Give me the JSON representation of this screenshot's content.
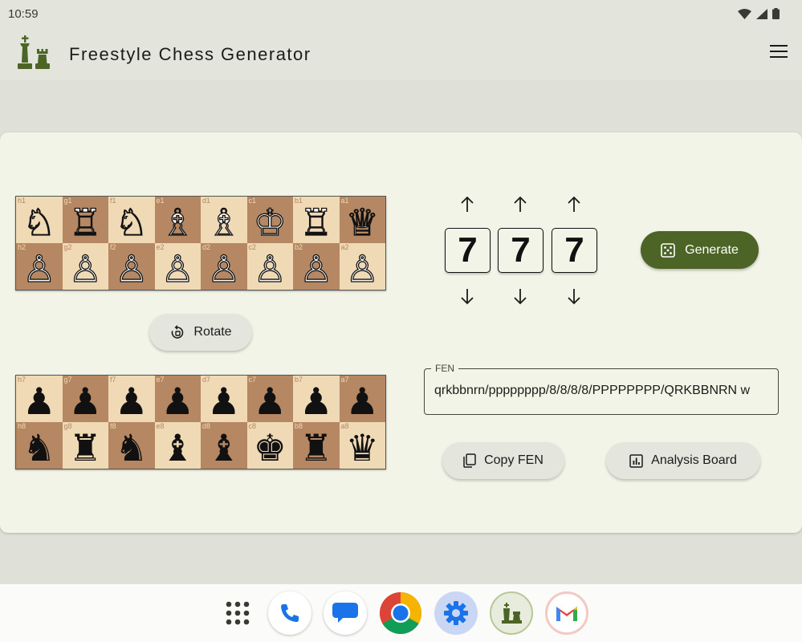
{
  "status_bar": {
    "time": "10:59"
  },
  "app_bar": {
    "title": "Freestyle Chess Generator"
  },
  "white_board": {
    "rows": [
      [
        {
          "coord": "h1",
          "glyph": "♘"
        },
        {
          "coord": "g1",
          "glyph": "♖"
        },
        {
          "coord": "f1",
          "glyph": "♘"
        },
        {
          "coord": "e1",
          "glyph": "♗"
        },
        {
          "coord": "d1",
          "glyph": "♗"
        },
        {
          "coord": "c1",
          "glyph": "♔"
        },
        {
          "coord": "b1",
          "glyph": "♖"
        },
        {
          "coord": "a1",
          "glyph": "♕"
        }
      ],
      [
        {
          "coord": "h2",
          "glyph": "♙"
        },
        {
          "coord": "g2",
          "glyph": "♙"
        },
        {
          "coord": "f2",
          "glyph": "♙"
        },
        {
          "coord": "e2",
          "glyph": "♙"
        },
        {
          "coord": "d2",
          "glyph": "♙"
        },
        {
          "coord": "c2",
          "glyph": "♙"
        },
        {
          "coord": "b2",
          "glyph": "♙"
        },
        {
          "coord": "a2",
          "glyph": "♙"
        }
      ]
    ]
  },
  "black_board": {
    "rows": [
      [
        {
          "coord": "h7",
          "glyph": "♟"
        },
        {
          "coord": "g7",
          "glyph": "♟"
        },
        {
          "coord": "f7",
          "glyph": "♟"
        },
        {
          "coord": "e7",
          "glyph": "♟"
        },
        {
          "coord": "d7",
          "glyph": "♟"
        },
        {
          "coord": "c7",
          "glyph": "♟"
        },
        {
          "coord": "b7",
          "glyph": "♟"
        },
        {
          "coord": "a7",
          "glyph": "♟"
        }
      ],
      [
        {
          "coord": "h8",
          "glyph": "♞"
        },
        {
          "coord": "g8",
          "glyph": "♜"
        },
        {
          "coord": "f8",
          "glyph": "♞"
        },
        {
          "coord": "e8",
          "glyph": "♝"
        },
        {
          "coord": "d8",
          "glyph": "♝"
        },
        {
          "coord": "c8",
          "glyph": "♚"
        },
        {
          "coord": "b8",
          "glyph": "♜"
        },
        {
          "coord": "a8",
          "glyph": "♛"
        }
      ]
    ]
  },
  "rotate_button": {
    "label": "Rotate",
    "icon": "rotate-icon"
  },
  "position_digits": [
    "7",
    "7",
    "7"
  ],
  "generate_button": {
    "label": "Generate",
    "icon": "dice-icon"
  },
  "fen": {
    "label": "FEN",
    "value": "qrkbbnrn/pppppppp/8/8/8/8/PPPPPPPP/QRKBBNRN w"
  },
  "copy_fen_button": {
    "label": "Copy FEN",
    "icon": "copy-icon"
  },
  "analysis_board_button": {
    "label": "Analysis Board",
    "icon": "chart-icon"
  },
  "colors": {
    "primary": "#4c6527",
    "background": "#dfe0d7",
    "surface": "#f1f4e7",
    "board_light": "#f0d9b5",
    "board_dark": "#b58863"
  },
  "dock": [
    {
      "name": "app-drawer-icon"
    },
    {
      "name": "phone-icon"
    },
    {
      "name": "messages-icon"
    },
    {
      "name": "chrome-icon"
    },
    {
      "name": "settings-icon"
    },
    {
      "name": "freestyle-chess-app-icon"
    },
    {
      "name": "gmail-icon"
    }
  ]
}
